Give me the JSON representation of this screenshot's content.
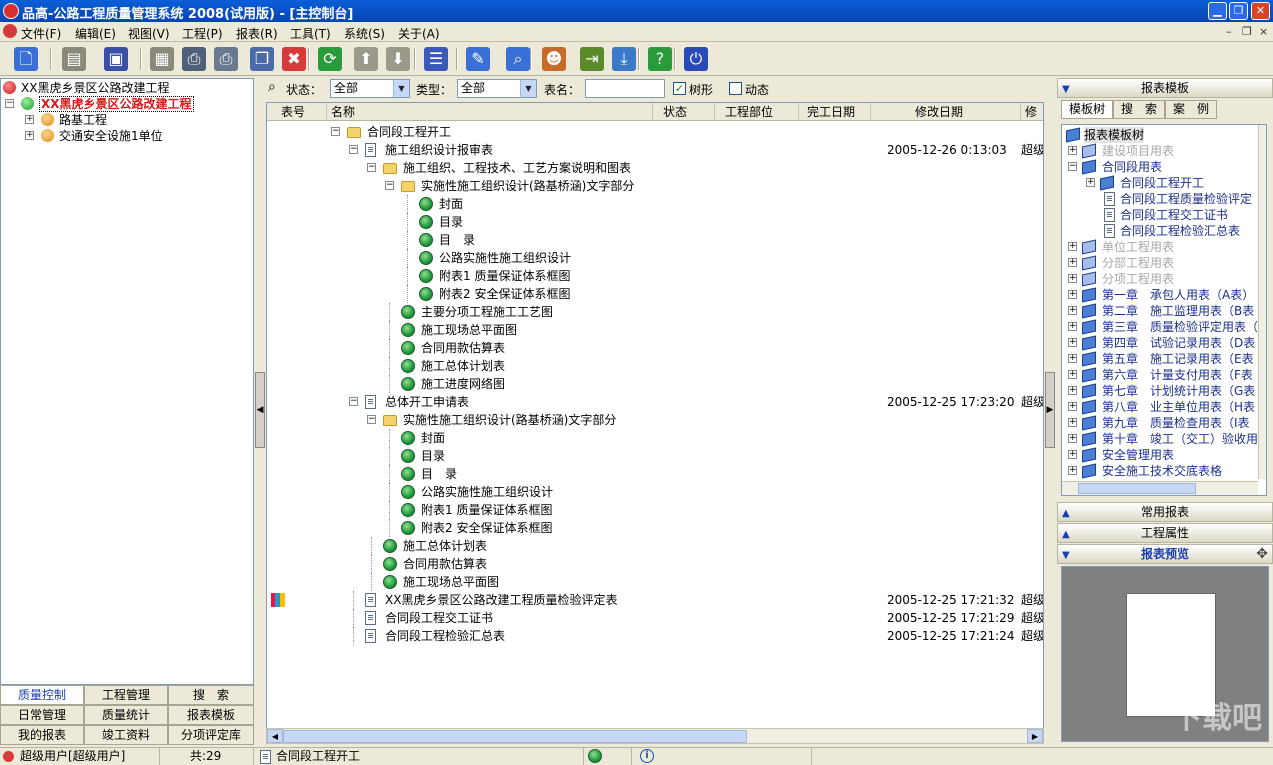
{
  "window": {
    "title": "品高-公路工程质量管理系统 2008(试用版) - [主控制台]",
    "min_glyph": "▁",
    "restore_glyph": "❐",
    "close_glyph": "✕"
  },
  "menu": {
    "items": [
      "文件(F)",
      "编辑(E)",
      "视图(V)",
      "工程(P)",
      "报表(R)",
      "工具(T)",
      "系统(S)",
      "关于(A)"
    ],
    "mdi_min": "–",
    "mdi_restore": "❐",
    "mdi_close": "×"
  },
  "toolbar": {
    "buttons": [
      {
        "icon": "new-document-icon",
        "glyph": "🗋",
        "color": "#3a6fd8"
      },
      {
        "icon": "open-folder-icon",
        "glyph": "▤",
        "color": "#8a8a7a"
      },
      {
        "icon": "save-icon",
        "glyph": "▣",
        "color": "#3a4fa8"
      },
      {
        "icon": "export-icon",
        "glyph": "▦",
        "color": "#8a8a7a"
      },
      {
        "icon": "print-icon",
        "glyph": "⎙",
        "color": "#506078"
      },
      {
        "icon": "print-preview-icon",
        "glyph": "⎙",
        "color": "#6a7890"
      },
      {
        "icon": "copy-icon",
        "glyph": "❐",
        "color": "#4a6aa8"
      },
      {
        "icon": "delete-icon",
        "glyph": "✖",
        "color": "#d83a3a"
      },
      {
        "icon": "refresh-icon",
        "glyph": "⟳",
        "color": "#2a9a3a"
      },
      {
        "icon": "move-up-icon",
        "glyph": "⬆",
        "color": "#9a9a8a"
      },
      {
        "icon": "move-down-icon",
        "glyph": "⬇",
        "color": "#9a9a8a"
      },
      {
        "icon": "list-icon",
        "glyph": "☰",
        "color": "#3a5ab8"
      },
      {
        "icon": "edit-icon",
        "glyph": "✎",
        "color": "#3a6fd8"
      },
      {
        "icon": "search-icon",
        "glyph": "⌕",
        "color": "#3a6fd8"
      },
      {
        "icon": "users-icon",
        "glyph": "☻",
        "color": "#c86a2a"
      },
      {
        "icon": "import-icon",
        "glyph": "⇥",
        "color": "#5a8a2a"
      },
      {
        "icon": "download-icon",
        "glyph": "⤓",
        "color": "#3a7ac8"
      },
      {
        "icon": "help-icon",
        "glyph": "?",
        "color": "#2a9a3a"
      },
      {
        "icon": "power-icon",
        "glyph": "⏻",
        "color": "#2a4ab8"
      }
    ]
  },
  "left_tree": {
    "root": "XX黑虎乡景区公路改建工程",
    "project": "XX黑虎乡景区公路改建工程",
    "children": [
      "路基工程",
      "交通安全设施1单位"
    ]
  },
  "left_tabs": [
    [
      "质量控制",
      "工程管理",
      "搜　索"
    ],
    [
      "日常管理",
      "质量统计",
      "报表模板"
    ],
    [
      "我的报表",
      "竣工资料",
      "分项评定库"
    ]
  ],
  "filter": {
    "status_label": "状态：",
    "status_value": "全部",
    "type_label": "类型：",
    "type_value": "全部",
    "name_label": "表名：",
    "name_value": "",
    "tree_label": "树形",
    "tree_checked": "✓",
    "dynamic_label": "动态"
  },
  "grid": {
    "columns": [
      "表号",
      "名称",
      "状态",
      "工程部位",
      "完工日期",
      "修改日期",
      "修"
    ],
    "rows": [
      {
        "level": 0,
        "icon": "folder",
        "exp": "−",
        "name": "合同段工程开工",
        "date": "",
        "who": ""
      },
      {
        "level": 1,
        "icon": "doc",
        "exp": "−",
        "name": "施工组织设计报审表",
        "date": "2005-12-26 0:13:03",
        "who": "超级"
      },
      {
        "level": 2,
        "icon": "folder",
        "exp": "−",
        "name": "施工组织、工程技术、工艺方案说明和图表",
        "date": "",
        "who": ""
      },
      {
        "level": 3,
        "icon": "folder",
        "exp": "−",
        "name": "实施性施工组织设计(路基桥涵)文字部分",
        "date": "",
        "who": ""
      },
      {
        "level": 4,
        "icon": "globe",
        "exp": "",
        "name": "封面",
        "date": "",
        "who": ""
      },
      {
        "level": 4,
        "icon": "globe",
        "exp": "",
        "name": "目录",
        "date": "",
        "who": ""
      },
      {
        "level": 4,
        "icon": "globe",
        "exp": "",
        "name": "目　录",
        "date": "",
        "who": ""
      },
      {
        "level": 4,
        "icon": "globe",
        "exp": "",
        "name": "公路实施性施工组织设计",
        "date": "",
        "who": ""
      },
      {
        "level": 4,
        "icon": "globe",
        "exp": "",
        "name": "附表1 质量保证体系框图",
        "date": "",
        "who": ""
      },
      {
        "level": 4,
        "icon": "globe",
        "exp": "",
        "name": "附表2 安全保证体系框图",
        "date": "",
        "who": ""
      },
      {
        "level": 3,
        "icon": "globe",
        "exp": "",
        "name": "主要分项工程施工工艺图",
        "date": "",
        "who": ""
      },
      {
        "level": 3,
        "icon": "globe",
        "exp": "",
        "name": "施工现场总平面图",
        "date": "",
        "who": ""
      },
      {
        "level": 3,
        "icon": "globe",
        "exp": "",
        "name": "合同用款估算表",
        "date": "",
        "who": ""
      },
      {
        "level": 3,
        "icon": "globe",
        "exp": "",
        "name": "施工总体计划表",
        "date": "",
        "who": ""
      },
      {
        "level": 3,
        "icon": "globe",
        "exp": "",
        "name": "施工进度网络图",
        "date": "",
        "who": ""
      },
      {
        "level": 1,
        "icon": "doc",
        "exp": "−",
        "name": "总体开工申请表",
        "date": "2005-12-25 17:23:20",
        "who": "超级"
      },
      {
        "level": 2,
        "icon": "folder",
        "exp": "−",
        "name": "实施性施工组织设计(路基桥涵)文字部分",
        "date": "",
        "who": ""
      },
      {
        "level": 3,
        "icon": "globe",
        "exp": "",
        "name": "封面",
        "date": "",
        "who": ""
      },
      {
        "level": 3,
        "icon": "globe",
        "exp": "",
        "name": "目录",
        "date": "",
        "who": ""
      },
      {
        "level": 3,
        "icon": "globe",
        "exp": "",
        "name": "目　录",
        "date": "",
        "who": ""
      },
      {
        "level": 3,
        "icon": "globe",
        "exp": "",
        "name": "公路实施性施工组织设计",
        "date": "",
        "who": ""
      },
      {
        "level": 3,
        "icon": "globe",
        "exp": "",
        "name": "附表1 质量保证体系框图",
        "date": "",
        "who": ""
      },
      {
        "level": 3,
        "icon": "globe",
        "exp": "",
        "name": "附表2 安全保证体系框图",
        "date": "",
        "who": ""
      },
      {
        "level": 2,
        "icon": "globe",
        "exp": "",
        "name": "施工总体计划表",
        "date": "",
        "who": ""
      },
      {
        "level": 2,
        "icon": "globe",
        "exp": "",
        "name": "合同用款估算表",
        "date": "",
        "who": ""
      },
      {
        "level": 2,
        "icon": "globe",
        "exp": "",
        "name": "施工现场总平面图",
        "date": "",
        "who": ""
      },
      {
        "level": 1,
        "icon": "doc",
        "exp": "",
        "name": "XX黑虎乡景区公路改建工程质量检验评定表",
        "date": "2005-12-25 17:21:32",
        "who": "超级",
        "chart": true
      },
      {
        "level": 1,
        "icon": "doc",
        "exp": "",
        "name": "合同段工程交工证书",
        "date": "2005-12-25 17:21:29",
        "who": "超级"
      },
      {
        "level": 1,
        "icon": "doc",
        "exp": "",
        "name": "合同段工程检验汇总表",
        "date": "2005-12-25 17:21:24",
        "who": "超级"
      }
    ]
  },
  "right": {
    "header": "报表模板",
    "tabs": [
      "模板树",
      "搜　索",
      "案　例"
    ],
    "tree_root": "报表模板树",
    "tree": [
      {
        "indent": 1,
        "exp": "+",
        "text": "建设项目用表",
        "grey": true,
        "type": "book"
      },
      {
        "indent": 1,
        "exp": "−",
        "text": "合同段用表",
        "grey": false,
        "type": "book"
      },
      {
        "indent": 2,
        "exp": "+",
        "text": "合同段工程开工",
        "grey": false,
        "type": "book"
      },
      {
        "indent": 2,
        "exp": "",
        "text": "合同段工程质量检验评定",
        "grey": false,
        "type": "doc"
      },
      {
        "indent": 2,
        "exp": "",
        "text": "合同段工程交工证书",
        "grey": false,
        "type": "doc"
      },
      {
        "indent": 2,
        "exp": "",
        "text": "合同段工程检验汇总表",
        "grey": false,
        "type": "doc"
      },
      {
        "indent": 1,
        "exp": "+",
        "text": "单位工程用表",
        "grey": true,
        "type": "book"
      },
      {
        "indent": 1,
        "exp": "+",
        "text": "分部工程用表",
        "grey": true,
        "type": "book"
      },
      {
        "indent": 1,
        "exp": "+",
        "text": "分项工程用表",
        "grey": true,
        "type": "book"
      },
      {
        "indent": 1,
        "exp": "+",
        "text": "第一章　承包人用表（A表）",
        "grey": false,
        "type": "book"
      },
      {
        "indent": 1,
        "exp": "+",
        "text": "第二章　施工监理用表（B表",
        "grey": false,
        "type": "book"
      },
      {
        "indent": 1,
        "exp": "+",
        "text": "第三章　质量检验评定用表（",
        "grey": false,
        "type": "book"
      },
      {
        "indent": 1,
        "exp": "+",
        "text": "第四章　试验记录用表（D表",
        "grey": false,
        "type": "book"
      },
      {
        "indent": 1,
        "exp": "+",
        "text": "第五章　施工记录用表（E表",
        "grey": false,
        "type": "book"
      },
      {
        "indent": 1,
        "exp": "+",
        "text": "第六章　计量支付用表（F表",
        "grey": false,
        "type": "book"
      },
      {
        "indent": 1,
        "exp": "+",
        "text": "第七章　计划统计用表（G表",
        "grey": false,
        "type": "book"
      },
      {
        "indent": 1,
        "exp": "+",
        "text": "第八章　业主单位用表（H表",
        "grey": false,
        "type": "book"
      },
      {
        "indent": 1,
        "exp": "+",
        "text": "第九章　质量检查用表（I表",
        "grey": false,
        "type": "book"
      },
      {
        "indent": 1,
        "exp": "+",
        "text": "第十章　竣工（交工）验收用",
        "grey": false,
        "type": "book"
      },
      {
        "indent": 1,
        "exp": "+",
        "text": "安全管理用表",
        "grey": false,
        "type": "book"
      },
      {
        "indent": 1,
        "exp": "+",
        "text": "安全施工技术交底表格",
        "grey": false,
        "type": "book"
      }
    ],
    "common_reports": "常用报表",
    "project_props": "工程属性",
    "preview": "报表预览",
    "watermark": "下载吧"
  },
  "status": {
    "user": "超级用户[超级用户]",
    "count": "共:29",
    "current": "合同段工程开工"
  }
}
